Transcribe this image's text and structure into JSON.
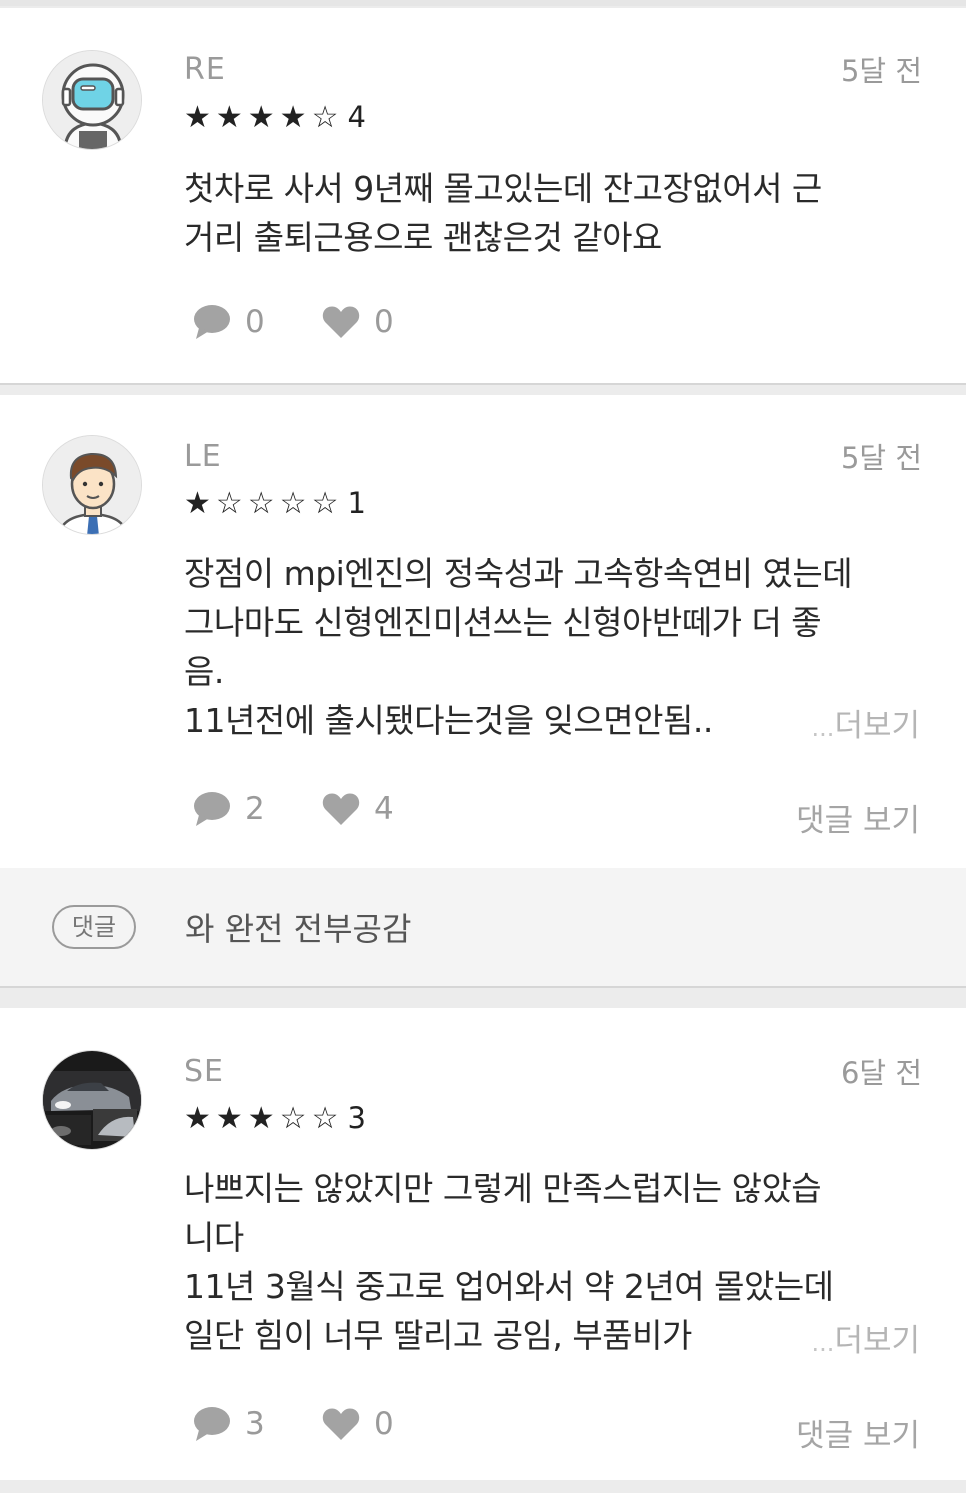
{
  "reviews": [
    {
      "username": "RE",
      "time": "5달 전",
      "stars": "★★★★☆",
      "rating": "4",
      "text": "첫차로 사서 9년째 몰고있는데 잔고장없어서 근\n거리 출퇴근용으로 괜찮은것 같아요",
      "comment_count": "0",
      "like_count": "0",
      "avatar_icon": "astronaut-avatar"
    },
    {
      "username": "LE",
      "time": "5달 전",
      "stars": "★☆☆☆☆",
      "rating": "1",
      "text": "장점이 mpi엔진의 정숙성과 고속항속연비 였는데\n그나마도 신형엔진미션쓰는 신형아반떼가 더 좋\n음.\n11년전에 출시됐다는것을 잊으면안됨..",
      "more_label": "더보기",
      "comment_count": "2",
      "like_count": "4",
      "view_replies_label": "댓글 보기",
      "reply": {
        "badge": "댓글",
        "text": "와 완전 전부공감"
      },
      "avatar_icon": "businessman-avatar"
    },
    {
      "username": "SE",
      "time": "6달 전",
      "stars": "★★★☆☆",
      "rating": "3",
      "text": "나쁘지는 않았지만 그렇게 만족스럽지는 않았습\n니다\n11년 3월식 중고로 업어와서 약 2년여 몰았는데\n일단 힘이 너무 딸리고 공임, 부품비가",
      "more_label": "더보기",
      "comment_count": "3",
      "like_count": "0",
      "view_replies_label": "댓글 보기",
      "avatar_icon": "car-photo-avatar"
    }
  ],
  "colors": {
    "background": "#ececec",
    "card": "#ffffff",
    "muted_text": "#9a9a9a",
    "icon_gray": "#a3a3a3"
  }
}
